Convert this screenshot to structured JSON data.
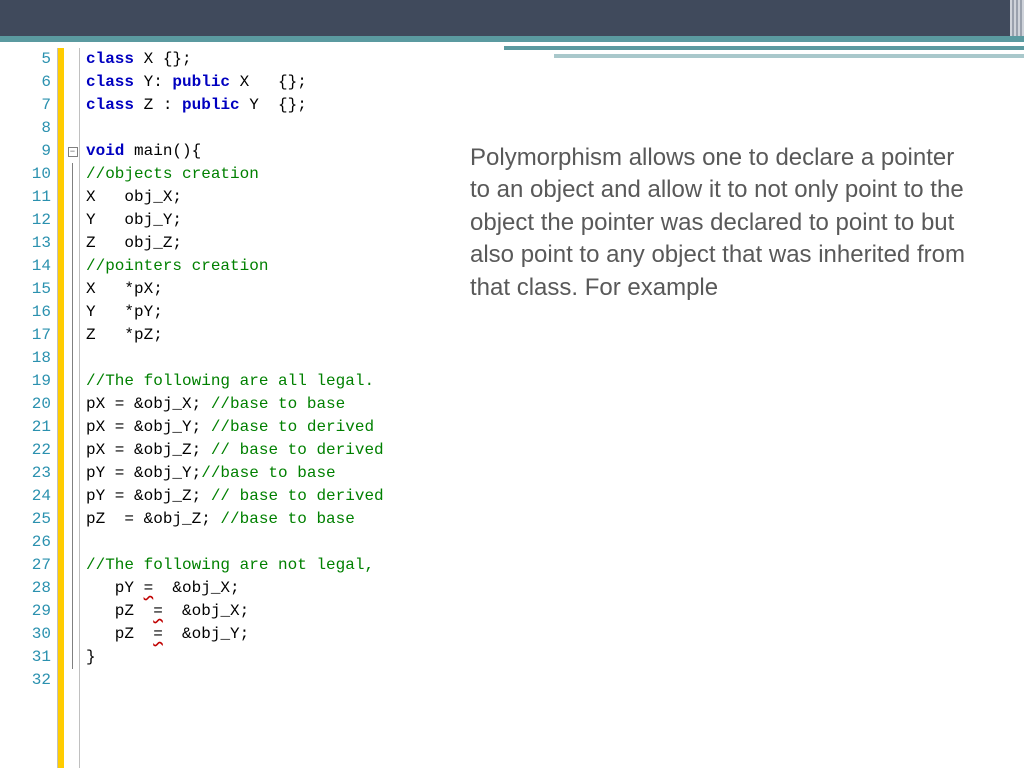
{
  "lines": [
    {
      "n": 5,
      "fold": null,
      "tokens": [
        [
          "kw",
          "class"
        ],
        [
          "pl",
          " X {};"
        ]
      ]
    },
    {
      "n": 6,
      "fold": null,
      "tokens": [
        [
          "kw",
          "class"
        ],
        [
          "pl",
          " Y: "
        ],
        [
          "kw",
          "public"
        ],
        [
          "pl",
          " X   {};"
        ]
      ]
    },
    {
      "n": 7,
      "fold": null,
      "tokens": [
        [
          "kw",
          "class"
        ],
        [
          "pl",
          " Z : "
        ],
        [
          "kw",
          "public"
        ],
        [
          "pl",
          " Y  {};"
        ]
      ]
    },
    {
      "n": 8,
      "fold": null,
      "tokens": []
    },
    {
      "n": 9,
      "fold": "box",
      "tokens": [
        [
          "kw",
          "void"
        ],
        [
          "pl",
          " main(){"
        ]
      ]
    },
    {
      "n": 10,
      "fold": "line",
      "tokens": [
        [
          "cm",
          "//objects creation"
        ]
      ]
    },
    {
      "n": 11,
      "fold": "line",
      "tokens": [
        [
          "pl",
          "X   obj_X;"
        ]
      ]
    },
    {
      "n": 12,
      "fold": "line",
      "tokens": [
        [
          "pl",
          "Y   obj_Y;"
        ]
      ]
    },
    {
      "n": 13,
      "fold": "line",
      "tokens": [
        [
          "pl",
          "Z   obj_Z;"
        ]
      ]
    },
    {
      "n": 14,
      "fold": "line",
      "tokens": [
        [
          "cm",
          "//pointers creation"
        ]
      ]
    },
    {
      "n": 15,
      "fold": "line",
      "tokens": [
        [
          "pl",
          "X   *pX;"
        ]
      ]
    },
    {
      "n": 16,
      "fold": "line",
      "tokens": [
        [
          "pl",
          "Y   *pY;"
        ]
      ]
    },
    {
      "n": 17,
      "fold": "line",
      "tokens": [
        [
          "pl",
          "Z   *pZ;"
        ]
      ]
    },
    {
      "n": 18,
      "fold": "line",
      "tokens": []
    },
    {
      "n": 19,
      "fold": "line",
      "tokens": [
        [
          "cm",
          "//The following are all legal."
        ]
      ]
    },
    {
      "n": 20,
      "fold": "line",
      "tokens": [
        [
          "pl",
          "pX = &obj_X; "
        ],
        [
          "cm",
          "//base to base"
        ]
      ]
    },
    {
      "n": 21,
      "fold": "line",
      "tokens": [
        [
          "pl",
          "pX = &obj_Y; "
        ],
        [
          "cm",
          "//base to derived"
        ]
      ]
    },
    {
      "n": 22,
      "fold": "line",
      "tokens": [
        [
          "pl",
          "pX = &obj_Z; "
        ],
        [
          "cm",
          "// base to derived"
        ]
      ]
    },
    {
      "n": 23,
      "fold": "line",
      "tokens": [
        [
          "pl",
          "pY = &obj_Y;"
        ],
        [
          "cm",
          "//base to base"
        ]
      ]
    },
    {
      "n": 24,
      "fold": "line",
      "tokens": [
        [
          "pl",
          "pY = &obj_Z; "
        ],
        [
          "cm",
          "// base to derived"
        ]
      ]
    },
    {
      "n": 25,
      "fold": "line",
      "tokens": [
        [
          "pl",
          "pZ  = &obj_Z; "
        ],
        [
          "cm",
          "//base to base"
        ]
      ]
    },
    {
      "n": 26,
      "fold": "line",
      "tokens": []
    },
    {
      "n": 27,
      "fold": "line",
      "tokens": [
        [
          "cm",
          "//The following are not legal,"
        ]
      ]
    },
    {
      "n": 28,
      "fold": "line",
      "tokens": [
        [
          "pl",
          "   pY "
        ],
        [
          "err",
          "="
        ],
        [
          "pl",
          "  &obj_X;"
        ]
      ]
    },
    {
      "n": 29,
      "fold": "line",
      "tokens": [
        [
          "pl",
          "   pZ  "
        ],
        [
          "err",
          "="
        ],
        [
          "pl",
          "  &obj_X;"
        ]
      ]
    },
    {
      "n": 30,
      "fold": "line",
      "tokens": [
        [
          "pl",
          "   pZ  "
        ],
        [
          "err",
          "="
        ],
        [
          "pl",
          "  &obj_Y;"
        ]
      ]
    },
    {
      "n": 31,
      "fold": "line",
      "tokens": [
        [
          "pl",
          "}"
        ]
      ]
    },
    {
      "n": 32,
      "fold": null,
      "tokens": []
    }
  ],
  "explain": "Polymorphism allows one to declare a pointer to an object and allow it to not only point to the object the pointer was declared to point to but also point to any object that was inherited from that class. For example",
  "fold_symbol": "−"
}
